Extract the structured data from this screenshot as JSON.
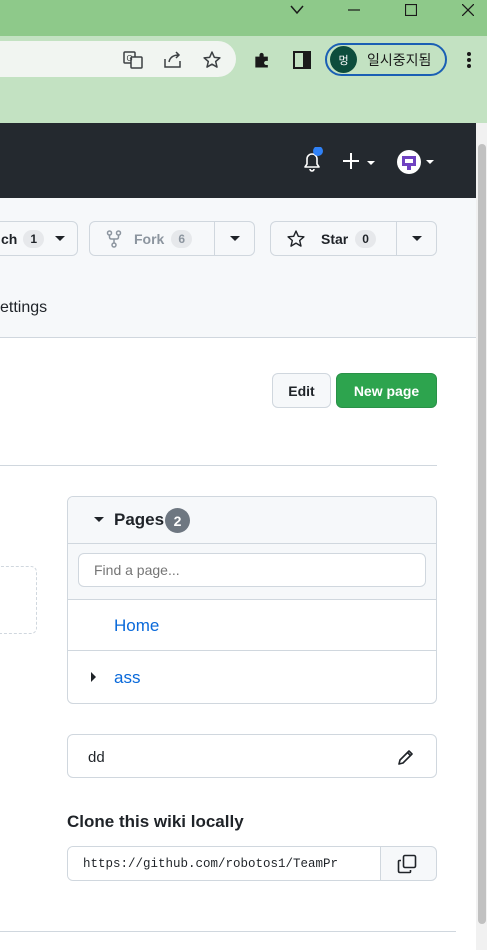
{
  "browser": {
    "profile_initial": "멍",
    "profile_status": "일시중지됨"
  },
  "repo": {
    "watch_label": "ch",
    "watch_count": "1",
    "fork_label": "Fork",
    "fork_count": "6",
    "star_label": "Star",
    "star_count": "0",
    "settings_tab": "ettings"
  },
  "wiki": {
    "edit_label": "Edit",
    "new_page_label": "New page",
    "pages_title": "Pages",
    "pages_count": "2",
    "find_placeholder": "Find a page...",
    "pages": [
      {
        "label": "Home"
      },
      {
        "label": "ass"
      }
    ],
    "sidebar_text": "dd",
    "clone_title": "Clone this wiki locally",
    "clone_url": "https://github.com/robotos1/TeamPr"
  },
  "colors": {
    "primary_green": "#2da44e",
    "header_dark": "#24292f",
    "link_blue": "#0969da",
    "chrome_green": "#8ec98a"
  }
}
